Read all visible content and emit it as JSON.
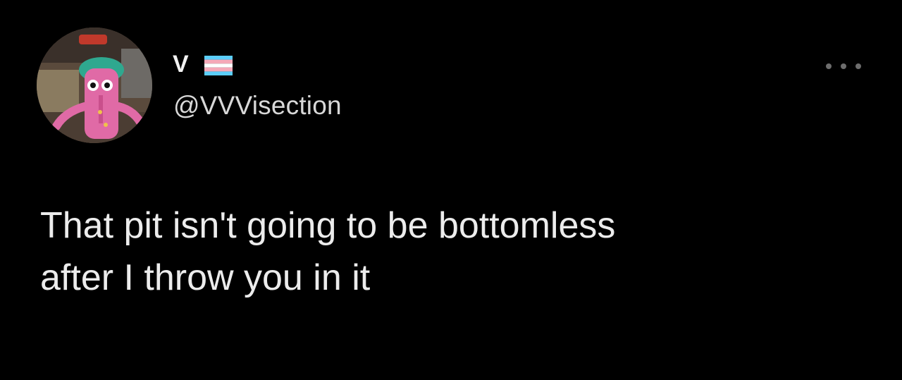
{
  "tweet": {
    "display_name": "V",
    "handle": "@VVVisection",
    "text": "That pit isn't going to be bottomless\nafter I throw you in it"
  },
  "icons": {
    "avatar": "avatar-image",
    "flag": "transgender-flag-icon",
    "more": "more-options-icon"
  },
  "colors": {
    "background": "#000000",
    "text": "#ececec",
    "handle": "#d8d8d8",
    "flag_blue": "#5BCEFA",
    "flag_pink": "#F5A9B8",
    "flag_white": "#FFFFFF"
  }
}
